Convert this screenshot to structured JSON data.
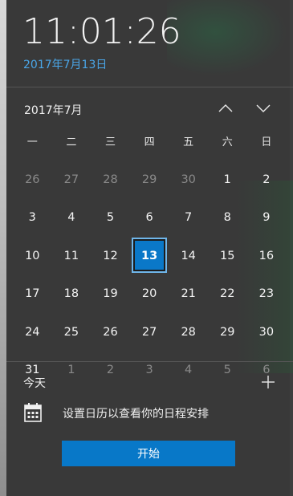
{
  "clock": {
    "time": "11:01:26",
    "date": "2017年7月13日"
  },
  "calendar": {
    "month_title": "2017年7月",
    "weekdays": [
      "一",
      "二",
      "三",
      "四",
      "五",
      "六",
      "日"
    ],
    "weeks": [
      [
        {
          "d": "26",
          "m": true
        },
        {
          "d": "27",
          "m": true
        },
        {
          "d": "28",
          "m": true
        },
        {
          "d": "29",
          "m": true
        },
        {
          "d": "30",
          "m": true
        },
        {
          "d": "1"
        },
        {
          "d": "2"
        }
      ],
      [
        {
          "d": "3"
        },
        {
          "d": "4"
        },
        {
          "d": "5"
        },
        {
          "d": "6"
        },
        {
          "d": "7"
        },
        {
          "d": "8"
        },
        {
          "d": "9"
        }
      ],
      [
        {
          "d": "10"
        },
        {
          "d": "11"
        },
        {
          "d": "12"
        },
        {
          "d": "13",
          "today": true
        },
        {
          "d": "14"
        },
        {
          "d": "15"
        },
        {
          "d": "16"
        }
      ],
      [
        {
          "d": "17"
        },
        {
          "d": "18"
        },
        {
          "d": "19"
        },
        {
          "d": "20"
        },
        {
          "d": "21"
        },
        {
          "d": "22"
        },
        {
          "d": "23"
        }
      ],
      [
        {
          "d": "24"
        },
        {
          "d": "25"
        },
        {
          "d": "26"
        },
        {
          "d": "27"
        },
        {
          "d": "28"
        },
        {
          "d": "29"
        },
        {
          "d": "30"
        }
      ],
      [
        {
          "d": "31"
        },
        {
          "d": "1",
          "m": true
        },
        {
          "d": "2",
          "m": true
        },
        {
          "d": "3",
          "m": true
        },
        {
          "d": "4",
          "m": true
        },
        {
          "d": "5",
          "m": true
        },
        {
          "d": "6",
          "m": true
        }
      ]
    ],
    "today_highlight_color": "#0a78c8",
    "nav_up_icon": "chevron-up-icon",
    "nav_down_icon": "chevron-down-icon"
  },
  "agenda": {
    "today_label": "今天",
    "add_icon": "plus-icon",
    "calendar_icon": "calendar-icon",
    "message": "设置日历以查看你的日程安排",
    "start_button": "开始",
    "accent_color": "#0878c8"
  }
}
